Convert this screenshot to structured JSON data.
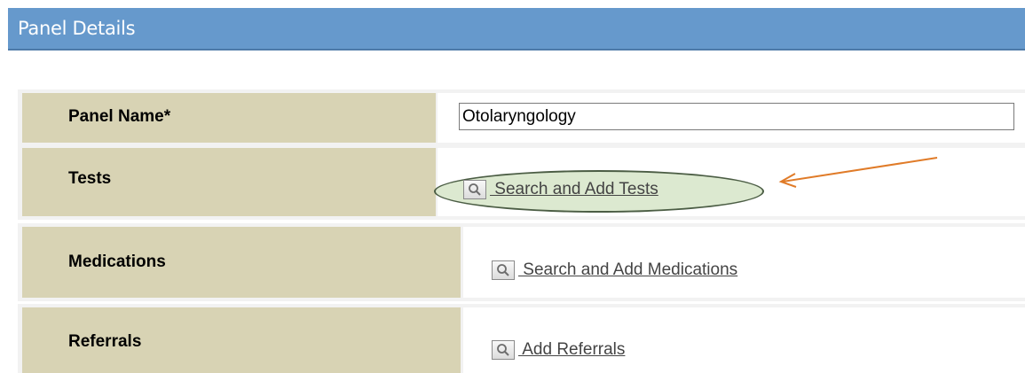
{
  "header": {
    "title": "Panel Details"
  },
  "form": {
    "panel_name": {
      "label": "Panel Name*",
      "value": "Otolaryngology"
    },
    "tests": {
      "label": "Tests",
      "link": " Search and Add Tests"
    },
    "medications": {
      "label": "Medications",
      "link": " Search and Add Medications"
    },
    "referrals": {
      "label": "Referrals",
      "link": " Add Referrals"
    }
  },
  "annotation": {
    "arrow_color": "#e07b28",
    "highlight_fill": "#dce9d0",
    "highlight_border": "#4b5d44"
  },
  "colors": {
    "header_bg": "#6699cc",
    "label_bg": "#d8d3b4",
    "row_bg": "#f2f2f2"
  },
  "icons": {
    "search": "magnifier-icon"
  }
}
